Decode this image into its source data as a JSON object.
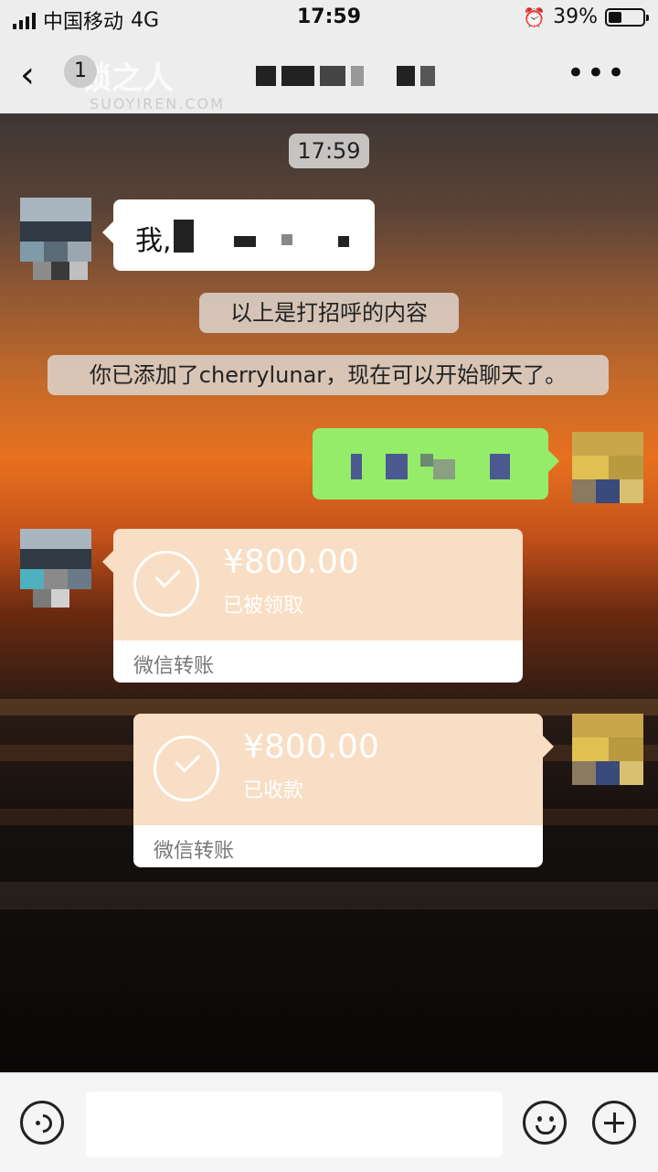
{
  "status_bar": {
    "carrier": "中国移动",
    "network": "4G",
    "time": "17:59",
    "battery_percent": "39%",
    "battery_level": 0.39
  },
  "header": {
    "back_icon": "chevron-left-icon",
    "badge": "1",
    "more_label": "•••",
    "watermark_cn": "锁之人",
    "watermark_en": "SUOYIREN.COM"
  },
  "chat": {
    "timestamp": "17:59",
    "incoming_text_prefix": "我,",
    "greeting_notice": "以上是打招呼的内容",
    "added_notice": "你已添加了cherrylunar，现在可以开始聊天了。",
    "transfer_1": {
      "amount": "¥800.00",
      "status": "已被领取",
      "label": "微信转账"
    },
    "transfer_2": {
      "amount": "¥800.00",
      "status": "已收款",
      "label": "微信转账"
    }
  },
  "colors": {
    "outgoing_bubble": "#95ec69",
    "transfer_card": "#f8dec4",
    "bar_bg": "#ededed"
  }
}
